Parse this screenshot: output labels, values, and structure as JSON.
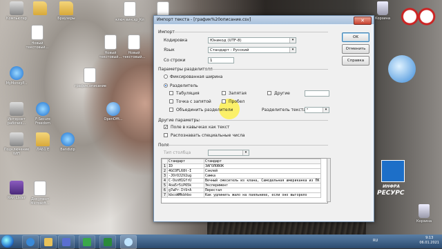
{
  "desktop": {
    "icons": [
      {
        "label": "Компьютер",
        "kind": "gray"
      },
      {
        "label": "",
        "kind": "folder"
      },
      {
        "label": "Браузеры",
        "kind": "folder"
      },
      {
        "label": "",
        "kind": "doc"
      },
      {
        "label": "ключ вин.хр_Кл",
        "kind": "doc"
      },
      {
        "label": "Корзина",
        "kind": "trash"
      },
      {
        "label": "Новый текстовый...",
        "kind": "doc"
      },
      {
        "label": "Новый текстовый...",
        "kind": "doc"
      },
      {
        "label": "Новый текстовый...",
        "kind": "doc"
      },
      {
        "label": "MyMoneyP...",
        "kind": "blue"
      },
      {
        "label": "график.описание",
        "kind": "doc"
      },
      {
        "label": "Интернет рабочих...",
        "kind": "gray"
      },
      {
        "label": "F-Secure Freedom",
        "kind": "blue"
      },
      {
        "label": "OpenOffi...",
        "kind": "ooo"
      },
      {
        "label": "Подключение WiFi",
        "kind": "gray"
      },
      {
        "label": "ЛАБ1 Е",
        "kind": "folder"
      },
      {
        "label": "Bandizip",
        "kind": "blue"
      },
      {
        "label": "RAR Lister",
        "kind": "rar"
      },
      {
        "label": "Документ Microsoft...",
        "kind": "doc"
      },
      {
        "label": "Корзина",
        "kind": "trash"
      }
    ],
    "gadget_logo": {
      "line1": "ИНФРА",
      "line2": "РЕСУРС"
    }
  },
  "dialog": {
    "title": "Импорт текста - [график%20описание.csv]",
    "close_glyph": "✕",
    "import_section": "Импорт",
    "encoding_label": "Кодировка",
    "encoding_value": "Юникод (UTF-8)",
    "language_label": "Язык",
    "language_value": "Стандарт - Русский",
    "from_row_label": "Со строки",
    "from_row_value": "1",
    "separator_section": "Параметры разделителя",
    "fixed_width_label": "Фиксированная ширина",
    "separated_label": "Разделитель",
    "tab_label": "Табуляция",
    "comma_label": "Запятая",
    "other_label": "Другие",
    "semicolon_label": "Точка с запятой",
    "space_label": "Пробел",
    "merge_label": "Объединить разделители",
    "text_delim_label": "Разделитель текста",
    "text_delim_value": "\"",
    "other_options_section": "Другие параметры",
    "quoted_as_text_label": "Поле в кавычках как текст",
    "detect_numbers_label": "Распознавать специальные числа",
    "fields_section": "Поля",
    "column_type_label": "Тип столбца",
    "column_type_value": "",
    "buttons": {
      "ok": "OK",
      "cancel": "Отменить",
      "help": "Справка"
    },
    "preview": {
      "headers": [
        "Стандарт",
        "Стандарт"
      ],
      "rows": [
        [
          "1",
          "ID",
          "ЗАГОЛОВОК"
        ],
        [
          "2",
          "4GCOFL68t-I",
          "Сэклей"
        ],
        [
          "3",
          "-JOrOJ2V2ug",
          "Самка"
        ],
        [
          "4",
          "C-OsnH1GfrU",
          "Вечный смеситель из клана, Самодельная американка из ПК"
        ],
        [
          "5",
          "4oa5r5iP65k",
          "Эксперимент"
        ],
        [
          "6",
          "g7wPr-It9rA",
          "Перестал"
        ],
        [
          "7",
          "kbcoWMkbhbo",
          "Как удлинить жало на паяльнике, если оно выгорело"
        ]
      ]
    }
  },
  "taskbar": {
    "language": "RU",
    "time": "9:13",
    "date": "06.01.2021"
  }
}
